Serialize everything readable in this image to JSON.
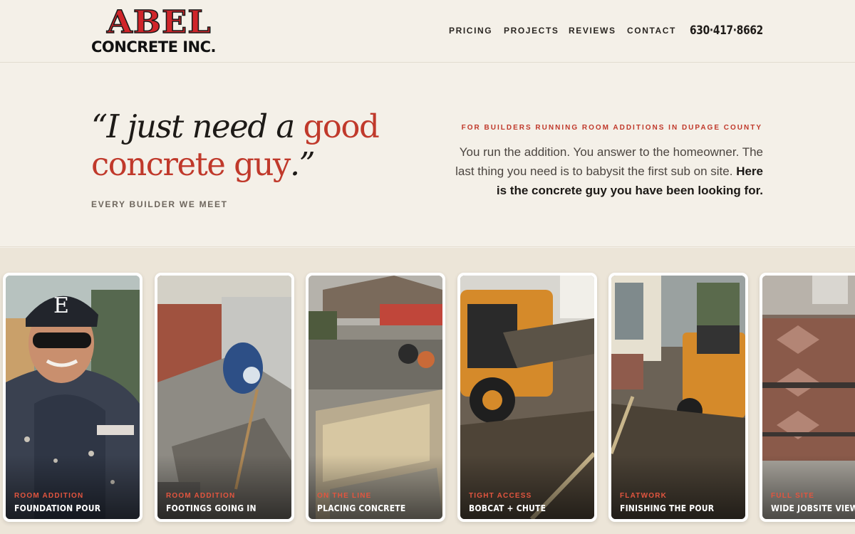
{
  "brand": {
    "line1": "ABEL",
    "line2": "CONCRETE INC."
  },
  "nav": {
    "pricing": "PRICING",
    "projects": "PROJECTS",
    "reviews": "REVIEWS",
    "contact": "CONTACT",
    "phone": "630·417·8662"
  },
  "hero": {
    "quote_open": "“I just need a",
    "quote_good": "good",
    "quote_line2": "concrete guy",
    "quote_close": ".”",
    "attribution": "EVERY BUILDER WE MEET",
    "eyebrow": "FOR BUILDERS RUNNING ROOM ADDITIONS IN DUPAGE COUNTY",
    "intro_plain": "You run the addition. You answer to the homeowner. The last thing you need is to babysit the first sub on site.",
    "intro_bold": "Here is the concrete guy you have been looking for."
  },
  "gallery": [
    {
      "tag": "ROOM ADDITION",
      "title": "FOUNDATION POUR"
    },
    {
      "tag": "ROOM ADDITION",
      "title": "FOOTINGS GOING IN"
    },
    {
      "tag": "ON THE LINE",
      "title": "PLACING CONCRETE"
    },
    {
      "tag": "TIGHT ACCESS",
      "title": "BOBCAT + CHUTE"
    },
    {
      "tag": "FLATWORK",
      "title": "FINISHING THE POUR"
    },
    {
      "tag": "FULL SITE",
      "title": "WIDE JOBSITE VIEW"
    }
  ],
  "colors": {
    "accent": "#c0392b",
    "background": "#f4f0e8",
    "gallery_bg": "#ece5d8",
    "text": "#2a2622"
  }
}
